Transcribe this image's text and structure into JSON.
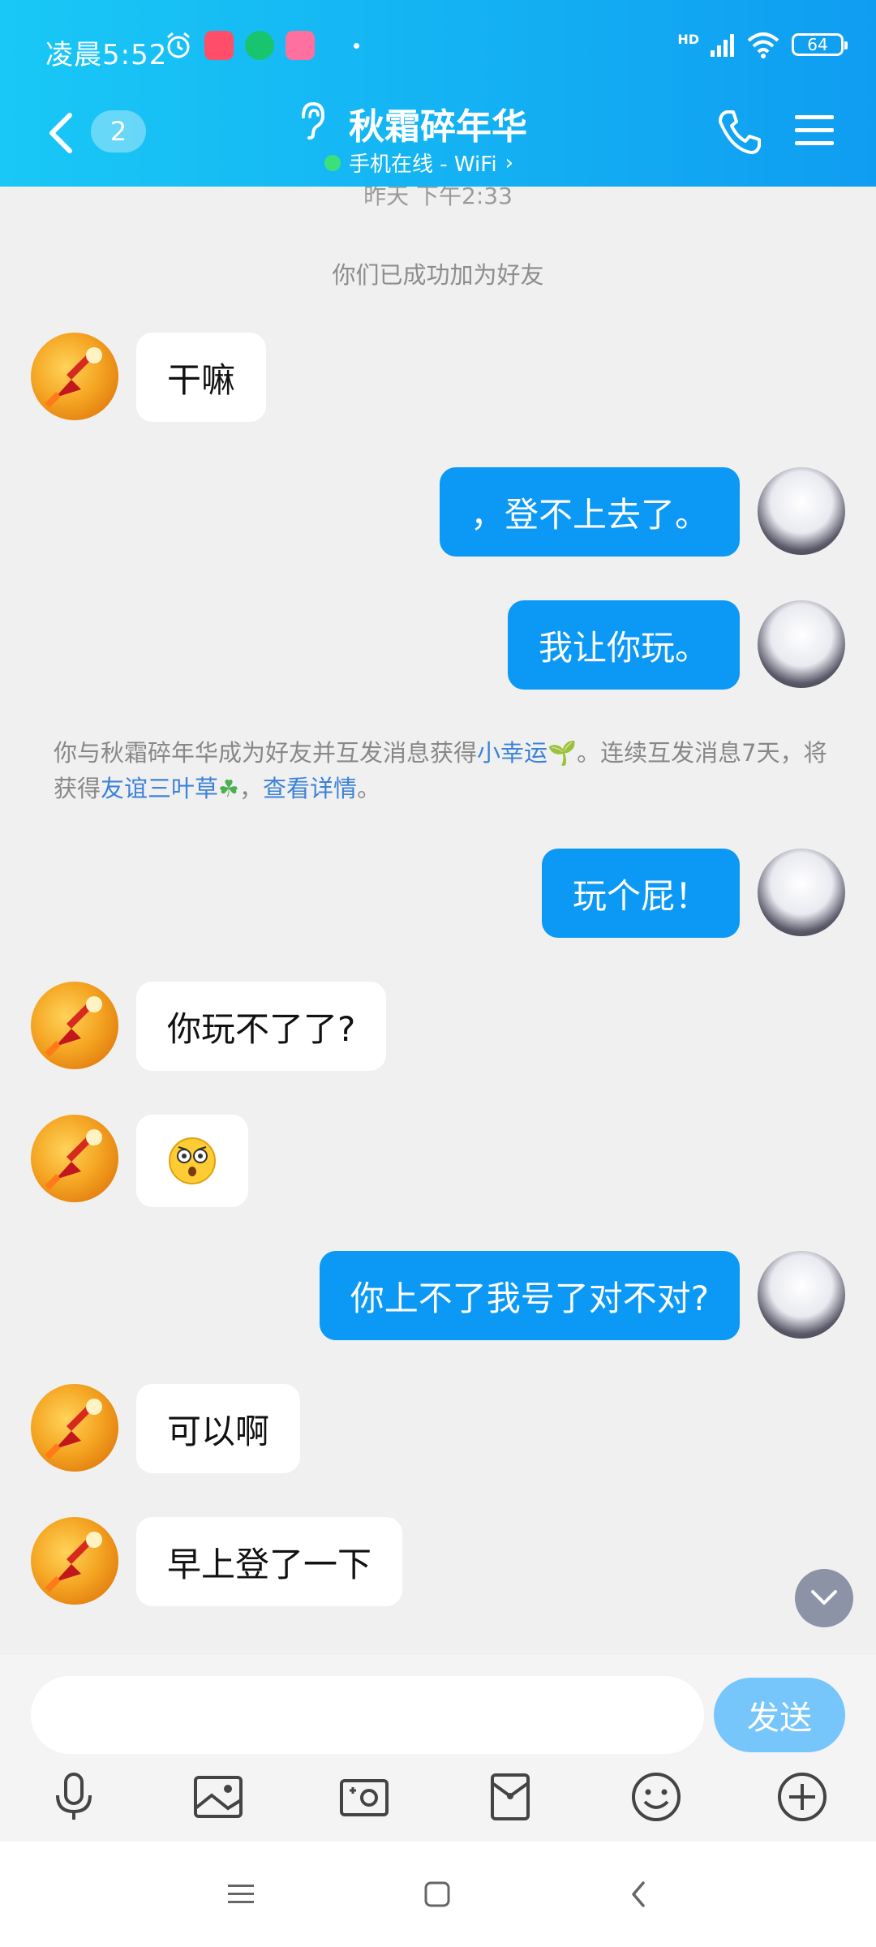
{
  "status_bar": {
    "time": "凌晨5:52",
    "battery": "64",
    "network": "HD"
  },
  "header": {
    "unread_count": "2",
    "title": "秋霜碎年华",
    "subtitle": "手机在线 - WiFi"
  },
  "chat": {
    "timestamp": "昨天 下午2:33",
    "system_message": "你们已成功加为好友",
    "messages": [
      {
        "from": "friend",
        "text": "干嘛"
      },
      {
        "from": "me",
        "text": "，登不上去了。"
      },
      {
        "from": "me",
        "text": "我让你玩。"
      },
      {
        "from": "me",
        "text": "玩个屁！"
      },
      {
        "from": "friend",
        "text": "你玩不了了?"
      },
      {
        "from": "friend",
        "text": "😳"
      },
      {
        "from": "me",
        "text": "你上不了我号了对不对?"
      },
      {
        "from": "friend",
        "text": "可以啊"
      },
      {
        "from": "friend",
        "text": "早上登了一下"
      }
    ],
    "notice": {
      "part1": "你与秋霜碎年华成为好友并互发消息获得",
      "link1": "小幸运",
      "part2": "。连续互发消息7天，将获得",
      "link2": "友谊三叶草",
      "part3": "，",
      "link3": "查看详情",
      "part4": "。"
    }
  },
  "input": {
    "placeholder": "",
    "send_label": "发送"
  },
  "toolbar": [
    "microphone-icon",
    "image-icon",
    "camera-icon",
    "red-packet-icon",
    "emoji-icon",
    "plus-icon"
  ],
  "colors": {
    "header_start": "#19c8f6",
    "header_end": "#0f9df1",
    "bubble_out": "#0b99f5",
    "send_button": "#77c6fb",
    "link": "#3c82d9"
  }
}
